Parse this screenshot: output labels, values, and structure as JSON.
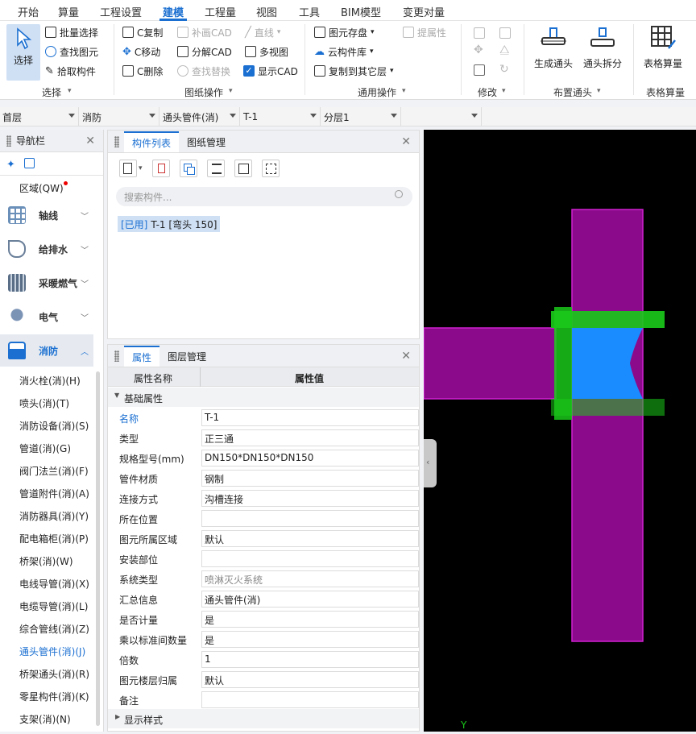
{
  "menu": {
    "items": [
      "开始",
      "算量",
      "工程设置",
      "建模",
      "工程量",
      "视图",
      "工具",
      "BIM模型",
      "变更对量"
    ]
  },
  "ribbon": {
    "select_group": {
      "select": "选择",
      "batch_select": "批量选择",
      "find_element": "查找图元",
      "pick_component": "拾取构件",
      "label": "选择"
    },
    "drawing_group": {
      "c_copy": "C复制",
      "c_move": "C移动",
      "c_delete": "C删除",
      "supplement_cad": "补画CAD",
      "decompose_cad": "分解CAD",
      "find_replace": "查找替换",
      "straight_line": "直线",
      "multi_view": "多视图",
      "show_cad": "显示CAD",
      "label": "图纸操作"
    },
    "general_group": {
      "element_save": "图元存盘",
      "cloud_library": "云构件库",
      "copy_to_floor": "复制到其它层",
      "extract_attr": "提属性",
      "label": "通用操作"
    },
    "modify_group": {
      "label": "修改"
    },
    "fitting_group": {
      "generate": "生成通头",
      "split": "通头拆分",
      "label": "布置通头"
    },
    "table_group": {
      "table_calc": "表格算量",
      "label": "表格算量"
    }
  },
  "selectors": {
    "floor": "首层",
    "discipline": "消防",
    "type": "通头管件(消)",
    "component": "T-1",
    "layer": "分层1"
  },
  "nav": {
    "title": "导航栏",
    "region": "区域(QW)",
    "categories": [
      "轴线",
      "给排水",
      "采暖燃气",
      "电气",
      "消防"
    ],
    "items": [
      "消火栓(消)(H)",
      "喷头(消)(T)",
      "消防设备(消)(S)",
      "管道(消)(G)",
      "阀门法兰(消)(F)",
      "管道附件(消)(A)",
      "消防器具(消)(Y)",
      "配电箱柜(消)(P)",
      "桥架(消)(W)",
      "电线导管(消)(X)",
      "电缆导管(消)(L)",
      "综合管线(消)(Z)",
      "通头管件(消)(J)",
      "桥架通头(消)(R)",
      "零星构件(消)(K)",
      "支架(消)(N)"
    ]
  },
  "component_panel": {
    "tab_list": "构件列表",
    "tab_drawing": "图纸管理",
    "search_placeholder": "搜索构件...",
    "entry_tag": "[已用]",
    "entry_text": "T-1 [弯头 150]"
  },
  "property_panel": {
    "tab_props": "属性",
    "tab_layers": "图层管理",
    "col_name": "属性名称",
    "col_value": "属性值",
    "section_basic": "基础属性",
    "section_display": "显示样式",
    "rows": [
      {
        "k": "名称",
        "v": "T-1"
      },
      {
        "k": "类型",
        "v": "正三通"
      },
      {
        "k": "规格型号(mm)",
        "v": "DN150*DN150*DN150"
      },
      {
        "k": "管件材质",
        "v": "钢制"
      },
      {
        "k": "连接方式",
        "v": "沟槽连接"
      },
      {
        "k": "所在位置",
        "v": ""
      },
      {
        "k": "图元所属区域",
        "v": "默认"
      },
      {
        "k": "安装部位",
        "v": ""
      },
      {
        "k": "系统类型",
        "v": "喷淋灭火系统"
      },
      {
        "k": "汇总信息",
        "v": "通头管件(消)"
      },
      {
        "k": "是否计量",
        "v": "是"
      },
      {
        "k": "乘以标准间数量",
        "v": "是"
      },
      {
        "k": "倍数",
        "v": "1"
      },
      {
        "k": "图元楼层归属",
        "v": "默认"
      },
      {
        "k": "备注",
        "v": ""
      }
    ]
  },
  "canvas": {
    "axis_label": "Y"
  },
  "colors": {
    "accent": "#1a6fd1",
    "pipe": "#8b0a8b",
    "pipe_border": "#d020d0",
    "fitting": "#1ab81a",
    "tee": "#1a8cff"
  }
}
